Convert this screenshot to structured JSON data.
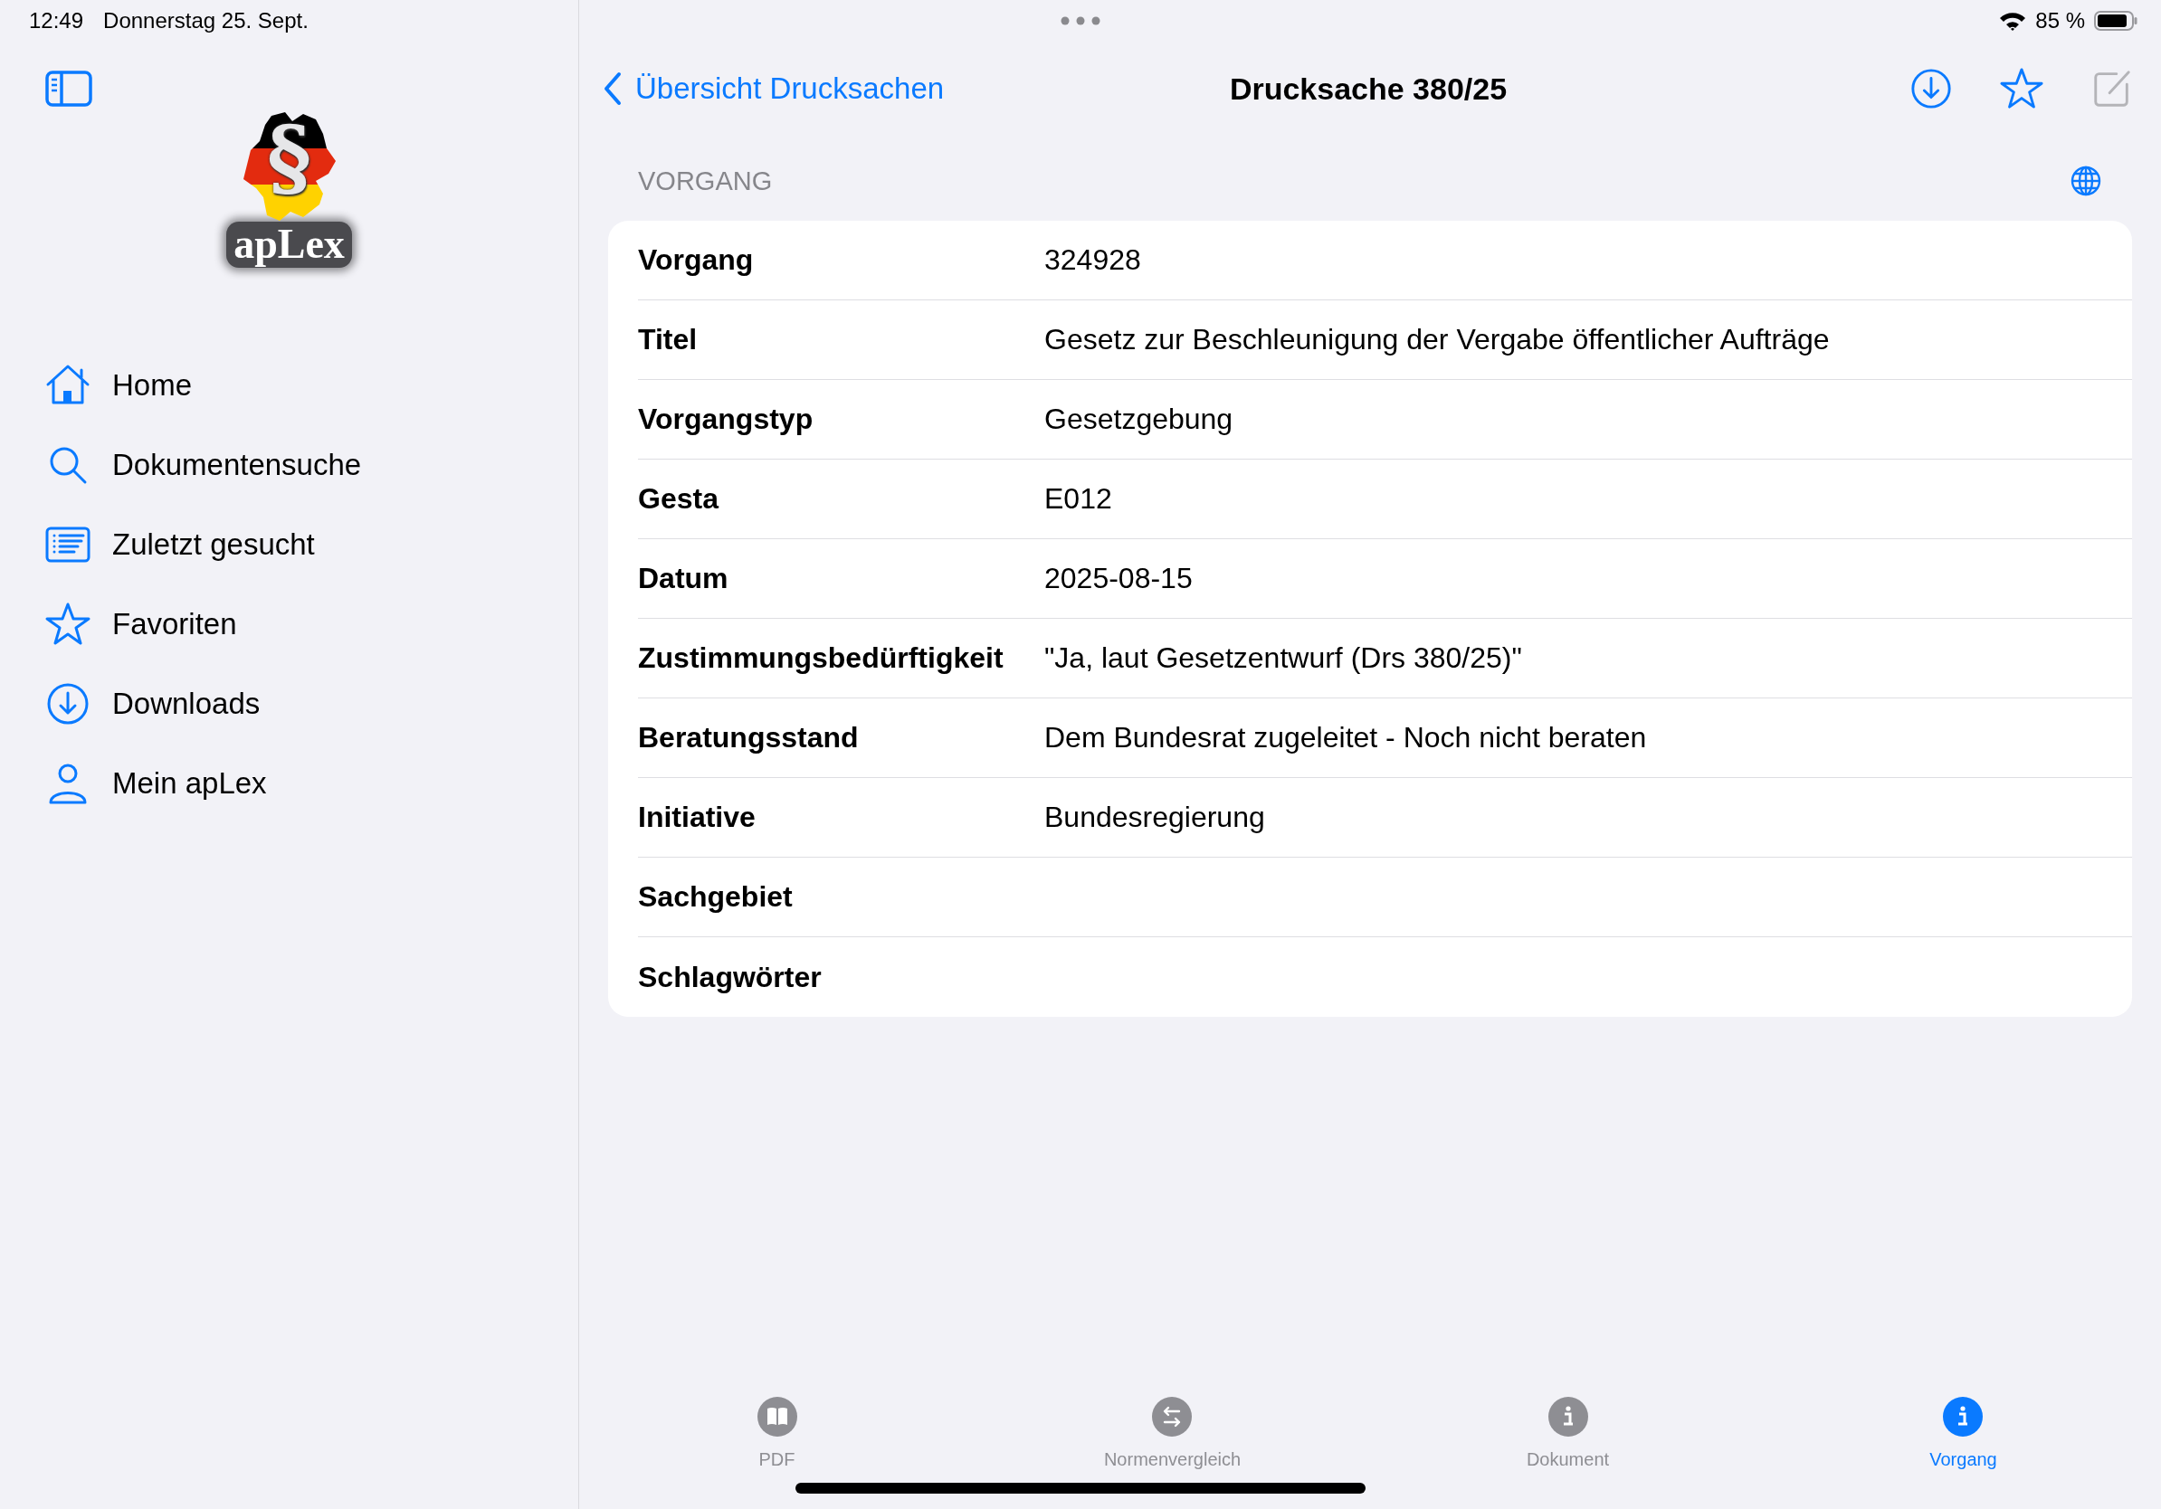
{
  "status_bar": {
    "time": "12:49",
    "date": "Donnerstag 25. Sept.",
    "battery": "85 %"
  },
  "sidebar": {
    "logo": {
      "mark": "§",
      "name": "apLex"
    },
    "items": [
      {
        "kind": "home",
        "label": "Home"
      },
      {
        "kind": "search",
        "label": "Dokumentensuche"
      },
      {
        "kind": "list",
        "label": "Zuletzt gesucht"
      },
      {
        "kind": "star",
        "label": "Favoriten"
      },
      {
        "kind": "download",
        "label": "Downloads"
      },
      {
        "kind": "person",
        "label": "Mein apLex"
      }
    ]
  },
  "nav_bar": {
    "back": "Übersicht Drucksachen",
    "title": "Drucksache 380/25",
    "actions": [
      {
        "kind": "download",
        "disabled": false
      },
      {
        "kind": "star",
        "disabled": false
      },
      {
        "kind": "edit",
        "disabled": true
      }
    ]
  },
  "section": {
    "header": "VORGANG",
    "rows": [
      {
        "label": "Vorgang",
        "value": "324928"
      },
      {
        "label": "Titel",
        "value": "Gesetz zur Beschleunigung der Vergabe öffentlicher Aufträge"
      },
      {
        "label": "Vorgangstyp",
        "value": "Gesetzgebung"
      },
      {
        "label": "Gesta",
        "value": "E012"
      },
      {
        "label": "Datum",
        "value": "2025-08-15"
      },
      {
        "label": "Zustimmungsbedürftigkeit",
        "value": "\"Ja, laut Gesetzentwurf (Drs 380/25)\""
      },
      {
        "label": "Beratungsstand",
        "value": "Dem Bundesrat zugeleitet - Noch nicht beraten"
      },
      {
        "label": "Initiative",
        "value": "Bundesregierung"
      },
      {
        "label": "Sachgebiet"
      },
      {
        "label": "Schlagwörter"
      }
    ]
  },
  "tab_bar": [
    {
      "kind": "book",
      "label": "PDF",
      "selected": false
    },
    {
      "kind": "compare",
      "label": "Normenvergleich",
      "selected": false
    },
    {
      "kind": "info",
      "label": "Dokument",
      "selected": false
    },
    {
      "kind": "info",
      "label": "Vorgang",
      "selected": true
    }
  ]
}
